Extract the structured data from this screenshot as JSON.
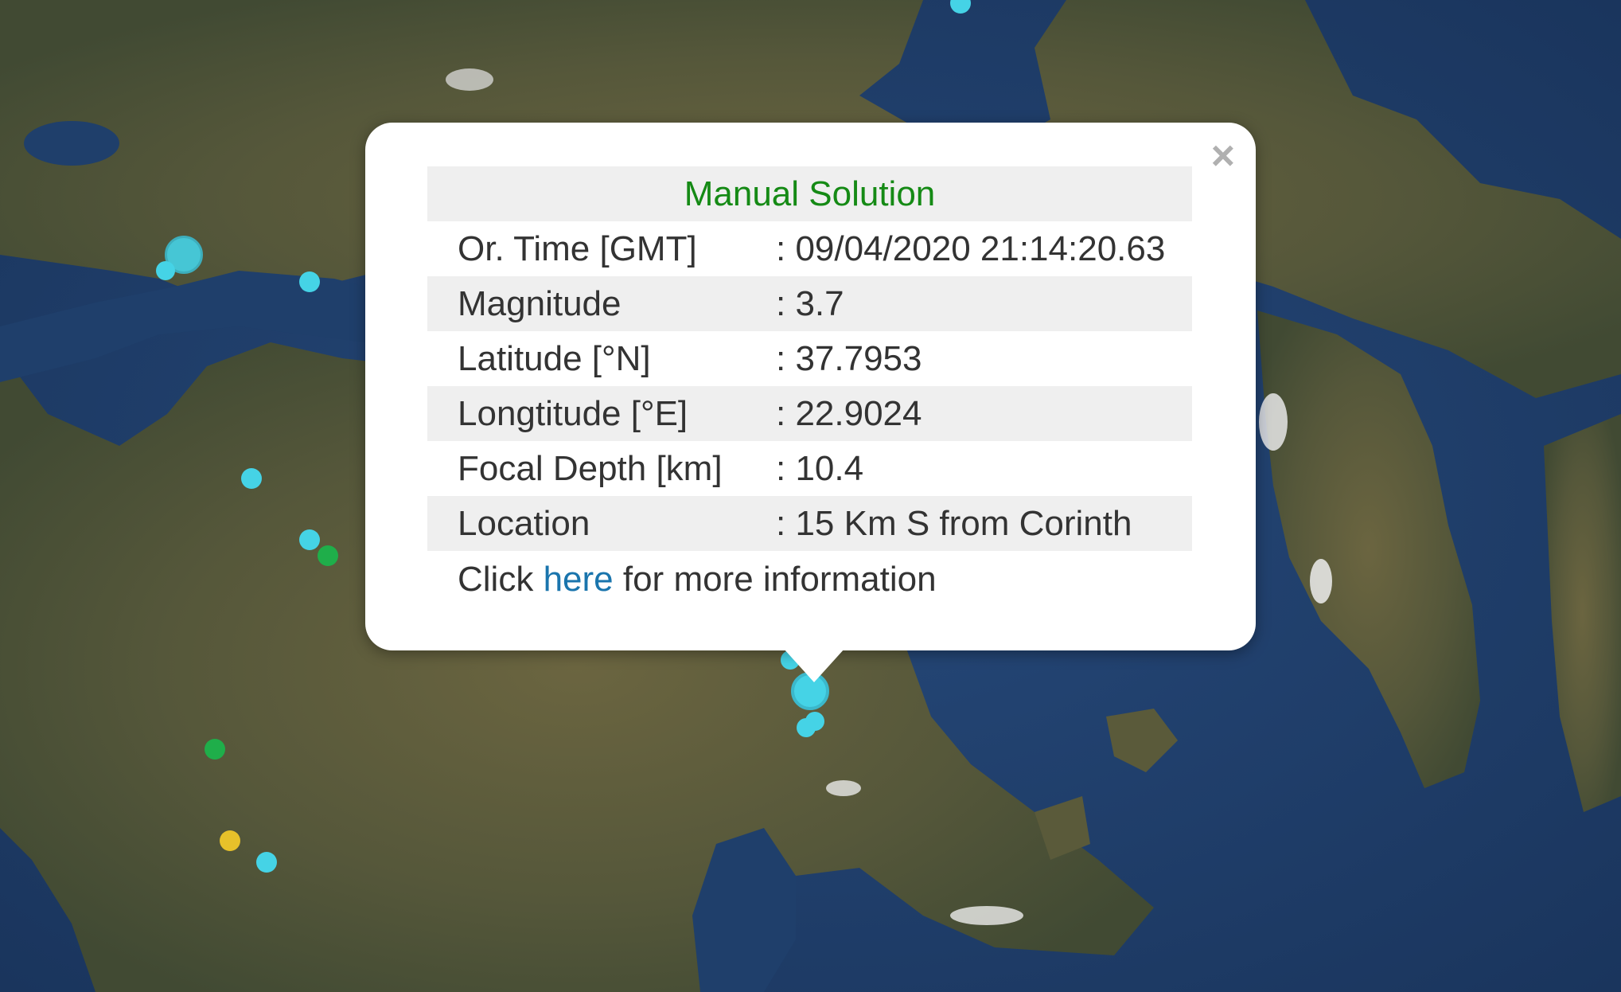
{
  "popup": {
    "title": "Manual Solution",
    "close_label": "×",
    "rows": [
      {
        "label": "Or. Time [GMT]",
        "value": ": 09/04/2020 21:14:20.63"
      },
      {
        "label": "Magnitude",
        "value": ": 3.7"
      },
      {
        "label": "Latitude [°N]",
        "value": ": 37.7953"
      },
      {
        "label": "Longtitude [°E]",
        "value": ": 22.9024"
      },
      {
        "label": "Focal Depth [km]",
        "value": ": 10.4"
      },
      {
        "label": "Location",
        "value": ": 15 Km S from Corinth"
      }
    ],
    "more_prefix": "Click ",
    "more_link": "here",
    "more_suffix": " for more information"
  },
  "colors": {
    "marker_cyan": "#45d3e6",
    "marker_green": "#1fae4a",
    "marker_yellow": "#e7c12a",
    "sea": "#1f3f6b",
    "land": "#5a5a3a",
    "title_green": "#158a15",
    "link_blue": "#1a75ad"
  }
}
